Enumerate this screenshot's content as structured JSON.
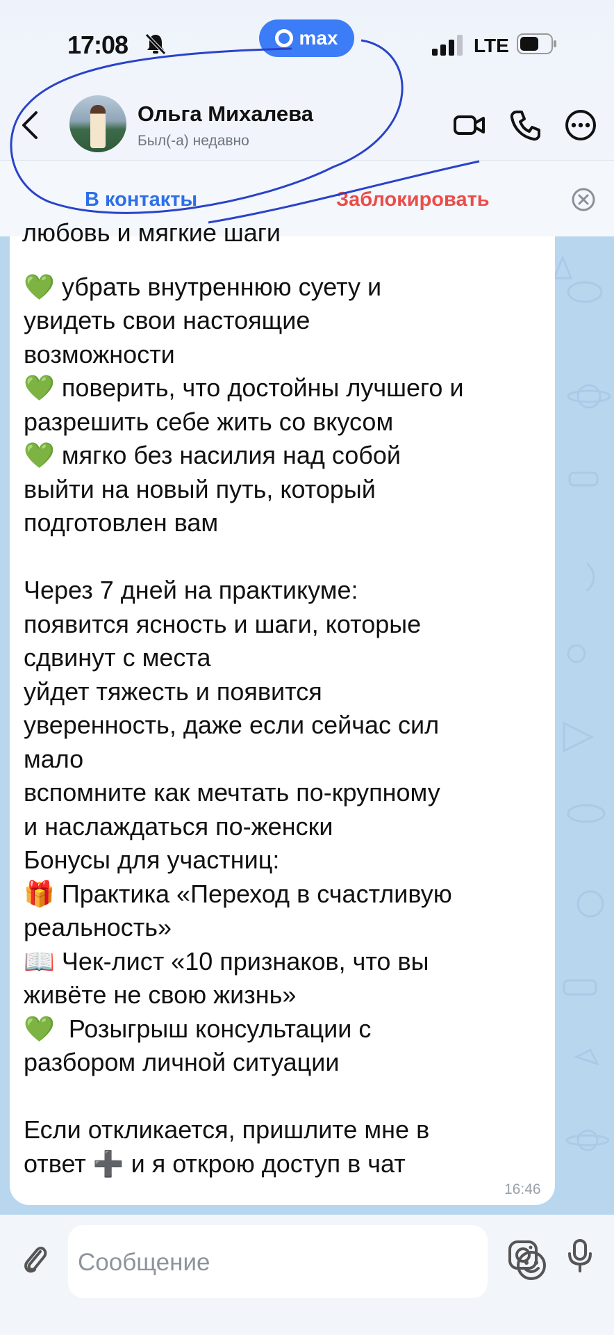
{
  "status_bar": {
    "time": "17:08",
    "app_badge": "max",
    "network": "LTE",
    "icons": [
      "silent-bell-icon",
      "cellular-signal-icon",
      "battery-icon"
    ]
  },
  "header": {
    "contact_name": "Ольга Михалева",
    "contact_status": "Был(-а) недавно",
    "icons": [
      "back-chevron-icon",
      "video-call-icon",
      "phone-icon",
      "more-icon"
    ]
  },
  "actions": {
    "add_contact": "В контакты",
    "block": "Заблокировать",
    "dismiss_icon": "close-circle-icon"
  },
  "message": {
    "cut_line": "любовь и мягкие шаги",
    "lines": [
      "",
      "💚 убрать внутреннюю суету и",
      "увидеть свои настоящие",
      "возможности",
      "💚 поверить, что достойны лучшего и",
      "разрешить себе жить со вкусом",
      "💚 мягко без насилия над собой",
      "выйти на новый путь, который",
      "подготовлен вам",
      "",
      "Через 7 дней на практикуме:",
      "появится ясность и шаги, которые",
      "сдвинут с места",
      "уйдет тяжесть и появится",
      "уверенность, даже если сейчас сил",
      "мало",
      "вспомните как мечтать по-крупному",
      "и наслаждаться по-женски",
      "Бонусы для участниц:",
      "🎁 Практика «Переход в счастливую",
      "реальность»",
      "📖 Чек-лист «10 признаков, что вы",
      "живёте не свою жизнь»",
      "💚  Розыгрыш консультации с",
      "разбором личной ситуации",
      "",
      "Если откликается, пришлите мне в",
      "ответ ➕ и я открою доступ в чат"
    ],
    "time": "16:46"
  },
  "composer": {
    "placeholder": "Сообщение",
    "icons": [
      "attach-icon",
      "emoji-icon",
      "camera-icon",
      "microphone-icon"
    ]
  },
  "colors": {
    "accent_blue": "#2d6fe6",
    "block_red": "#ea4d49",
    "chat_background": "#b9d6ef",
    "annotation_ink": "#2a43c9"
  }
}
